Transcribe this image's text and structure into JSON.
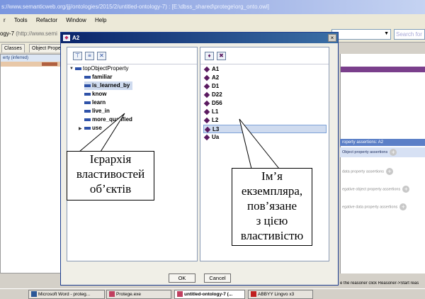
{
  "main_window": {
    "title": "s://www.semanticweb.org/jjj/ontologies/2015/2/untitled-ontology-7) : [E:\\dbss_shared\\protege\\org_onto.owl]",
    "menu": [
      "r",
      "Tools",
      "Refactor",
      "Window",
      "Help"
    ],
    "ontology_label": "ogy-7",
    "ontology_url": "(http://www.semi",
    "search_placeholder": "Search for",
    "tabs": [
      "Classes",
      "Object Prope"
    ],
    "left_panel_header": "erty (inferred)",
    "property_assertions_header": "roperty assertions: A2",
    "assertions": {
      "object": "Object property assertions",
      "data": "data property assertions",
      "neg_object": "egative object property assertions",
      "neg_data": "egative data property assertions"
    },
    "reasoner_hint": "e the reasoner click Reasoner->Start reas"
  },
  "taskbar": {
    "items": [
      {
        "label": "Microsoft Word - proteg...",
        "active": false
      },
      {
        "label": "Protege.exe",
        "active": false
      },
      {
        "label": "untitled-ontology-7 (...",
        "active": true
      },
      {
        "label": "ABBYY Lingvo x3",
        "active": false
      }
    ]
  },
  "dialog": {
    "title": "A2",
    "property_tree": {
      "root": "topObjectProperty",
      "children": [
        "familiar",
        "is_learned_by",
        "know",
        "learn",
        "live_in",
        "more_qualified",
        "use"
      ],
      "selected": "is_learned_by"
    },
    "individuals": {
      "items": [
        "A1",
        "A2",
        "D1",
        "D22",
        "D56",
        "L1",
        "L2",
        "L3",
        "Ua"
      ],
      "selected": "L3"
    },
    "ok_label": "OK",
    "cancel_label": "Cancel"
  },
  "callouts": {
    "left": [
      "Ієрархія",
      "властивостей",
      "об’єктів"
    ],
    "right": [
      "Ім’я",
      "екземпляра,",
      "пов’язане",
      "з цією",
      "властивістю"
    ]
  },
  "colors": {
    "dialog_title": "#0a246a",
    "selection": "#cfdbef",
    "individual_diamond": "#5a1a60",
    "property_icon": "#2f52a8"
  }
}
